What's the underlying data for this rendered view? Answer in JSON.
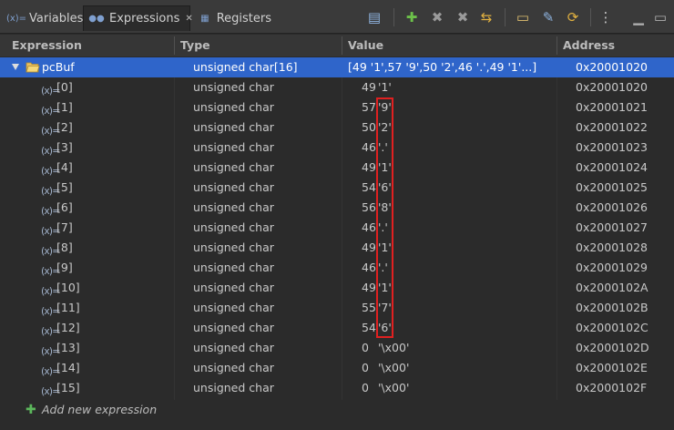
{
  "tabs": [
    {
      "label": "Variables",
      "icon": "variables-icon"
    },
    {
      "label": "Expressions",
      "icon": "expressions-icon",
      "close": "✕"
    },
    {
      "label": "Registers",
      "icon": "registers-icon"
    }
  ],
  "toolbar": {
    "icons": [
      "collapse-all-icon",
      "add-expression-icon",
      "remove-icon",
      "remove-all-icon",
      "refresh-icon",
      "new-window-icon",
      "edit-icon",
      "link-icon",
      "menu-icon",
      "minimize-icon",
      "maximize-icon"
    ]
  },
  "columns": {
    "expression": "Expression",
    "type": "Type",
    "value": "Value",
    "address": "Address"
  },
  "root": {
    "name": "pcBuf",
    "type": "unsigned char[16]",
    "value": "[49 '1',57 '9',50 '2',46 '.',49 '1'...]",
    "address": "0x20001020"
  },
  "children": [
    {
      "name": "[0]",
      "type": "unsigned char",
      "num": "49",
      "char": "'1'",
      "address": "0x20001020"
    },
    {
      "name": "[1]",
      "type": "unsigned char",
      "num": "57",
      "char": "'9'",
      "address": "0x20001021"
    },
    {
      "name": "[2]",
      "type": "unsigned char",
      "num": "50",
      "char": "'2'",
      "address": "0x20001022"
    },
    {
      "name": "[3]",
      "type": "unsigned char",
      "num": "46",
      "char": "'.'",
      "address": "0x20001023"
    },
    {
      "name": "[4]",
      "type": "unsigned char",
      "num": "49",
      "char": "'1'",
      "address": "0x20001024"
    },
    {
      "name": "[5]",
      "type": "unsigned char",
      "num": "54",
      "char": "'6'",
      "address": "0x20001025"
    },
    {
      "name": "[6]",
      "type": "unsigned char",
      "num": "56",
      "char": "'8'",
      "address": "0x20001026"
    },
    {
      "name": "[7]",
      "type": "unsigned char",
      "num": "46",
      "char": "'.'",
      "address": "0x20001027"
    },
    {
      "name": "[8]",
      "type": "unsigned char",
      "num": "49",
      "char": "'1'",
      "address": "0x20001028"
    },
    {
      "name": "[9]",
      "type": "unsigned char",
      "num": "46",
      "char": "'.'",
      "address": "0x20001029"
    },
    {
      "name": "[10]",
      "type": "unsigned char",
      "num": "49",
      "char": "'1'",
      "address": "0x2000102A"
    },
    {
      "name": "[11]",
      "type": "unsigned char",
      "num": "55",
      "char": "'7'",
      "address": "0x2000102B"
    },
    {
      "name": "[12]",
      "type": "unsigned char",
      "num": "54",
      "char": "'6'",
      "address": "0x2000102C"
    },
    {
      "name": "[13]",
      "type": "unsigned char",
      "num": "0",
      "char": "'\\x00'",
      "address": "0x2000102D"
    },
    {
      "name": "[14]",
      "type": "unsigned char",
      "num": "0",
      "char": "'\\x00'",
      "address": "0x2000102E"
    },
    {
      "name": "[15]",
      "type": "unsigned char",
      "num": "0",
      "char": "'\\x00'",
      "address": "0x2000102F"
    }
  ],
  "add_expression": "Add new expression",
  "colors": {
    "selection": "#2f65ca",
    "highlight_box": "#e02020",
    "add_icon": "#5cb85c"
  }
}
